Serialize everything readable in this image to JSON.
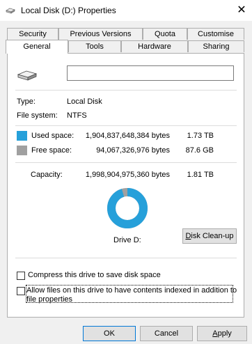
{
  "window": {
    "title": "Local Disk (D:) Properties",
    "close_glyph": "✕"
  },
  "tabs": {
    "row1": [
      "Security",
      "Previous Versions",
      "Quota",
      "Customise"
    ],
    "row2": [
      "General",
      "Tools",
      "Hardware",
      "Sharing"
    ],
    "active": "General"
  },
  "general": {
    "name_value": "",
    "type_label": "Type:",
    "type_value": "Local Disk",
    "fs_label": "File system:",
    "fs_value": "NTFS",
    "used": {
      "label": "Used space:",
      "bytes": "1,904,837,648,384 bytes",
      "size": "1.73 TB",
      "color": "#26a0da"
    },
    "free": {
      "label": "Free space:",
      "bytes": "94,067,326,976 bytes",
      "size": "87.6 GB",
      "color": "#a0a0a0"
    },
    "capacity": {
      "label": "Capacity:",
      "bytes": "1,998,904,975,360 bytes",
      "size": "1.81 TB"
    },
    "used_fraction": 0.953,
    "drive_label": "Drive D:",
    "cleanup_button": "Disk Clean-up",
    "compress_label": "Compress this drive to save disk space",
    "compress_checked": false,
    "index_label_1": "Allow files on this drive to have contents indexed in addition to",
    "index_label_2": "file properties",
    "index_checked": false
  },
  "buttons": {
    "ok": "OK",
    "cancel": "Cancel",
    "apply": "Apply"
  },
  "icons": {
    "title_icon": "drive-icon",
    "drive_icon": "drive-icon"
  }
}
